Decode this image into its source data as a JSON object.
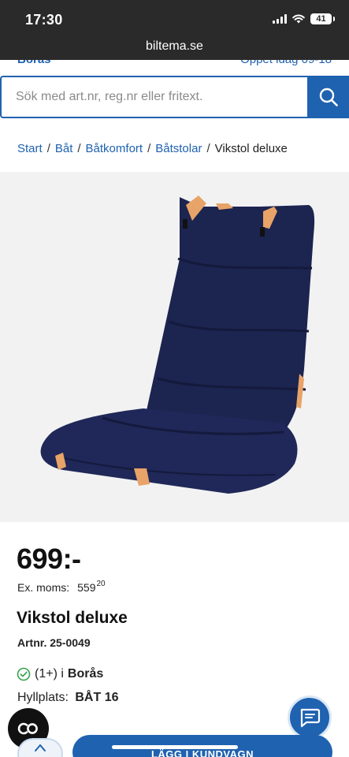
{
  "status_bar": {
    "time": "17:30",
    "battery": "41"
  },
  "browser": {
    "url": "biltema.se"
  },
  "header": {
    "store_name": "Borås",
    "opening_hours": "Öppet idag 09-18"
  },
  "search": {
    "placeholder": "Sök med art.nr, reg.nr eller fritext.",
    "value": ""
  },
  "breadcrumb": {
    "items": [
      "Start",
      "Båt",
      "Båtkomfort",
      "Båtstolar"
    ],
    "current": "Vikstol deluxe"
  },
  "product": {
    "price": "699:-",
    "ex_vat_label": "Ex. moms:",
    "ex_vat_int": "559",
    "ex_vat_dec": "20",
    "name": "Vikstol deluxe",
    "article_number": "Artnr. 25-0049",
    "stock_count": "(1+) i",
    "stock_store": "Borås",
    "shelf_label": "Hyllplats:",
    "shelf_value": "BÅT 16",
    "image_color": "#1c2450"
  },
  "actions": {
    "add_to_cart": "LÄGG I KUNDVAGN"
  },
  "colors": {
    "brand_blue": "#1f62b0",
    "status_bg": "#2a2a2a",
    "check_green": "#3aa14a"
  }
}
